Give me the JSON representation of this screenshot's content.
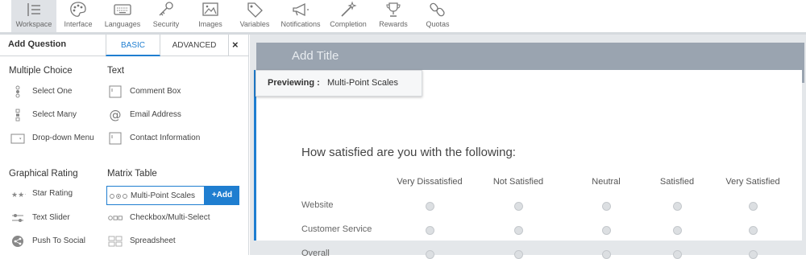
{
  "toolbar": {
    "items": [
      {
        "label": "Workspace",
        "icon": "list-icon"
      },
      {
        "label": "Interface",
        "icon": "palette-icon"
      },
      {
        "label": "Languages",
        "icon": "keyboard-icon"
      },
      {
        "label": "Security",
        "icon": "key-icon"
      },
      {
        "label": "Images",
        "icon": "image-icon"
      },
      {
        "label": "Variables",
        "icon": "tag-icon"
      },
      {
        "label": "Notifications",
        "icon": "megaphone-icon"
      },
      {
        "label": "Completion",
        "icon": "magic-wand-icon"
      },
      {
        "label": "Rewards",
        "icon": "trophy-icon"
      },
      {
        "label": "Quotas",
        "icon": "link-icon"
      }
    ],
    "active": "Workspace"
  },
  "panel": {
    "title": "Add Question",
    "tabs": [
      {
        "label": "BASIC",
        "active": true
      },
      {
        "label": "ADVANCED",
        "active": false
      }
    ],
    "close": "×",
    "categories": {
      "multiple_choice": "Multiple Choice",
      "text": "Text",
      "graphical_rating": "Graphical Rating",
      "matrix_table": "Matrix Table"
    },
    "items": {
      "select_one": "Select One",
      "select_many": "Select Many",
      "dropdown_menu": "Drop-down Menu",
      "comment_box": "Comment Box",
      "email_address": "Email Address",
      "contact_information": "Contact Information",
      "star_rating": "Star Rating",
      "text_slider": "Text Slider",
      "push_to_social": "Push To Social",
      "multi_point_scales": "Multi-Point Scales",
      "add_button": "+Add",
      "checkbox_multi_select": "Checkbox/Multi-Select",
      "spreadsheet": "Spreadsheet"
    }
  },
  "canvas": {
    "add_title": "Add Title",
    "preview_label": "Previewing :",
    "preview_value": "Multi-Point Scales",
    "question": "How satisfied are you with the following:",
    "columns": [
      "Very Dissatisfied",
      "Not Satisfied",
      "Neutral",
      "Satisfied",
      "Very Satisfied"
    ],
    "rows": [
      "Website",
      "Customer Service",
      "Overall"
    ]
  },
  "colors": {
    "accent": "#1f7ed0",
    "title_bar": "#9aa4b0",
    "canvas_bg": "#e4e7ea"
  }
}
